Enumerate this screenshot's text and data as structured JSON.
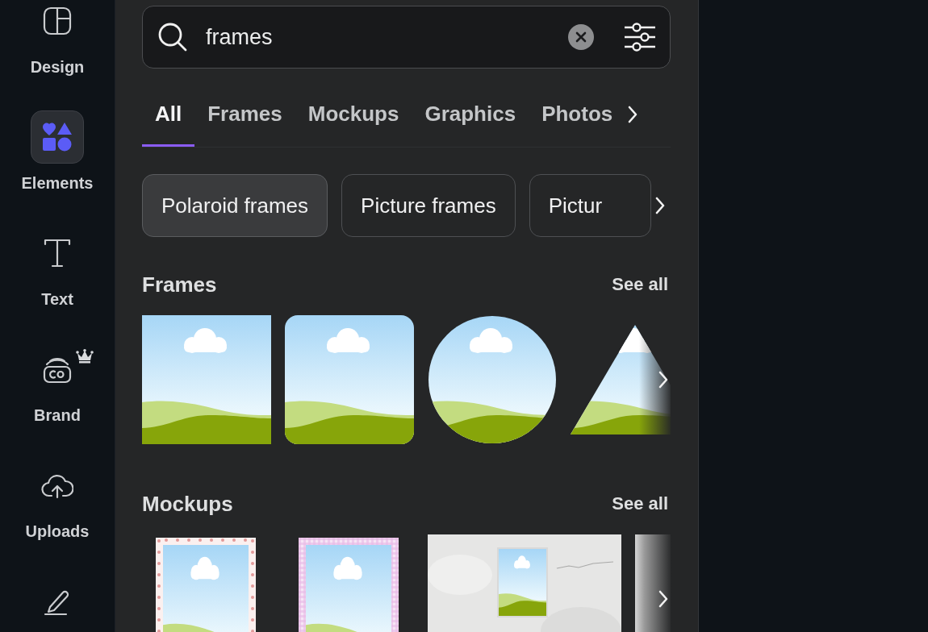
{
  "sidebar": {
    "items": [
      {
        "label": "Design",
        "selected": false,
        "premium": false
      },
      {
        "label": "Elements",
        "selected": true,
        "premium": false
      },
      {
        "label": "Text",
        "selected": false,
        "premium": false
      },
      {
        "label": "Brand",
        "selected": false,
        "premium": true
      },
      {
        "label": "Uploads",
        "selected": false,
        "premium": false
      },
      {
        "selected": false,
        "premium": false
      }
    ]
  },
  "search": {
    "value": "frames"
  },
  "tabs": [
    {
      "label": "All",
      "selected": true
    },
    {
      "label": "Frames",
      "selected": false
    },
    {
      "label": "Mockups",
      "selected": false
    },
    {
      "label": "Graphics",
      "selected": false
    },
    {
      "label": "Photos",
      "selected": false
    }
  ],
  "chips": [
    {
      "label": "Polaroid frames",
      "selected": true
    },
    {
      "label": "Picture frames",
      "selected": false
    },
    {
      "label": "Pictur",
      "selected": false
    }
  ],
  "sections": [
    {
      "title": "Frames",
      "action": "See all",
      "items": [
        {
          "kind": "square"
        },
        {
          "kind": "rounded"
        },
        {
          "kind": "circle"
        },
        {
          "kind": "triangle"
        }
      ]
    },
    {
      "title": "Mockups",
      "action": "See all",
      "items": [
        {
          "kind": "hearts"
        },
        {
          "kind": "gingham"
        },
        {
          "kind": "wall"
        },
        {
          "kind": "edge"
        }
      ]
    }
  ]
}
